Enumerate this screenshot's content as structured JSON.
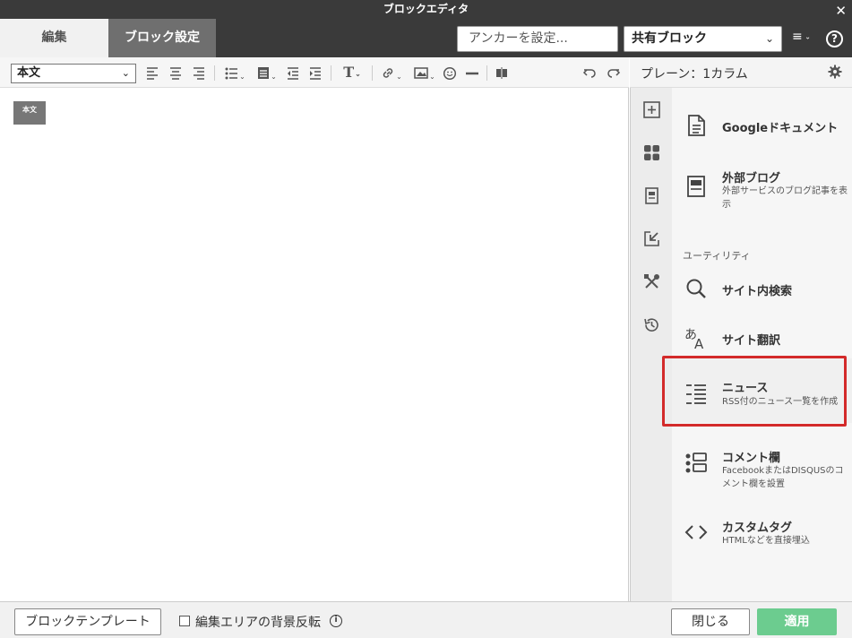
{
  "window": {
    "title": "ブロックエディタ",
    "close_glyph": "✕"
  },
  "header": {
    "tabs": [
      {
        "label": "編集"
      },
      {
        "label": "ブロック設定"
      }
    ],
    "anchor_placeholder": "アンカーを設定...",
    "shared_block_value": "共有ブロック",
    "menu_glyph": "≡",
    "help_glyph": "?"
  },
  "toolbar": {
    "style_value": "本文",
    "heading_glyph": "T"
  },
  "editor": {
    "block_label": "本文"
  },
  "panel": {
    "title": "プレーン：1カラム",
    "section_utility": "ユーティリティ",
    "items": [
      {
        "name": "Googleドキュメント",
        "desc": "",
        "icon": "document-icon"
      },
      {
        "name": "外部ブログ",
        "desc": "外部サービスのブログ記事を表示",
        "icon": "external-blog-icon"
      },
      {
        "name": "サイト内検索",
        "desc": "",
        "icon": "search-icon"
      },
      {
        "name": "サイト翻訳",
        "desc": "",
        "icon": "translate-icon"
      },
      {
        "name": "ニュース",
        "desc": "RSS付のニュース一覧を作成",
        "icon": "news-list-icon"
      },
      {
        "name": "コメント欄",
        "desc": "FacebookまたはDISQUSのコメント欄を設置",
        "icon": "comment-icon"
      },
      {
        "name": "カスタムタグ",
        "desc": "HTMLなどを直接埋込",
        "icon": "code-icon"
      }
    ],
    "highlight_color": "#d32a2a"
  },
  "footer": {
    "template_label": "ブロックテンプレート",
    "invert_label": "編集エリアの背景反転",
    "close_label": "閉じる",
    "apply_label": "適用",
    "apply_color": "#6ccc8f"
  }
}
